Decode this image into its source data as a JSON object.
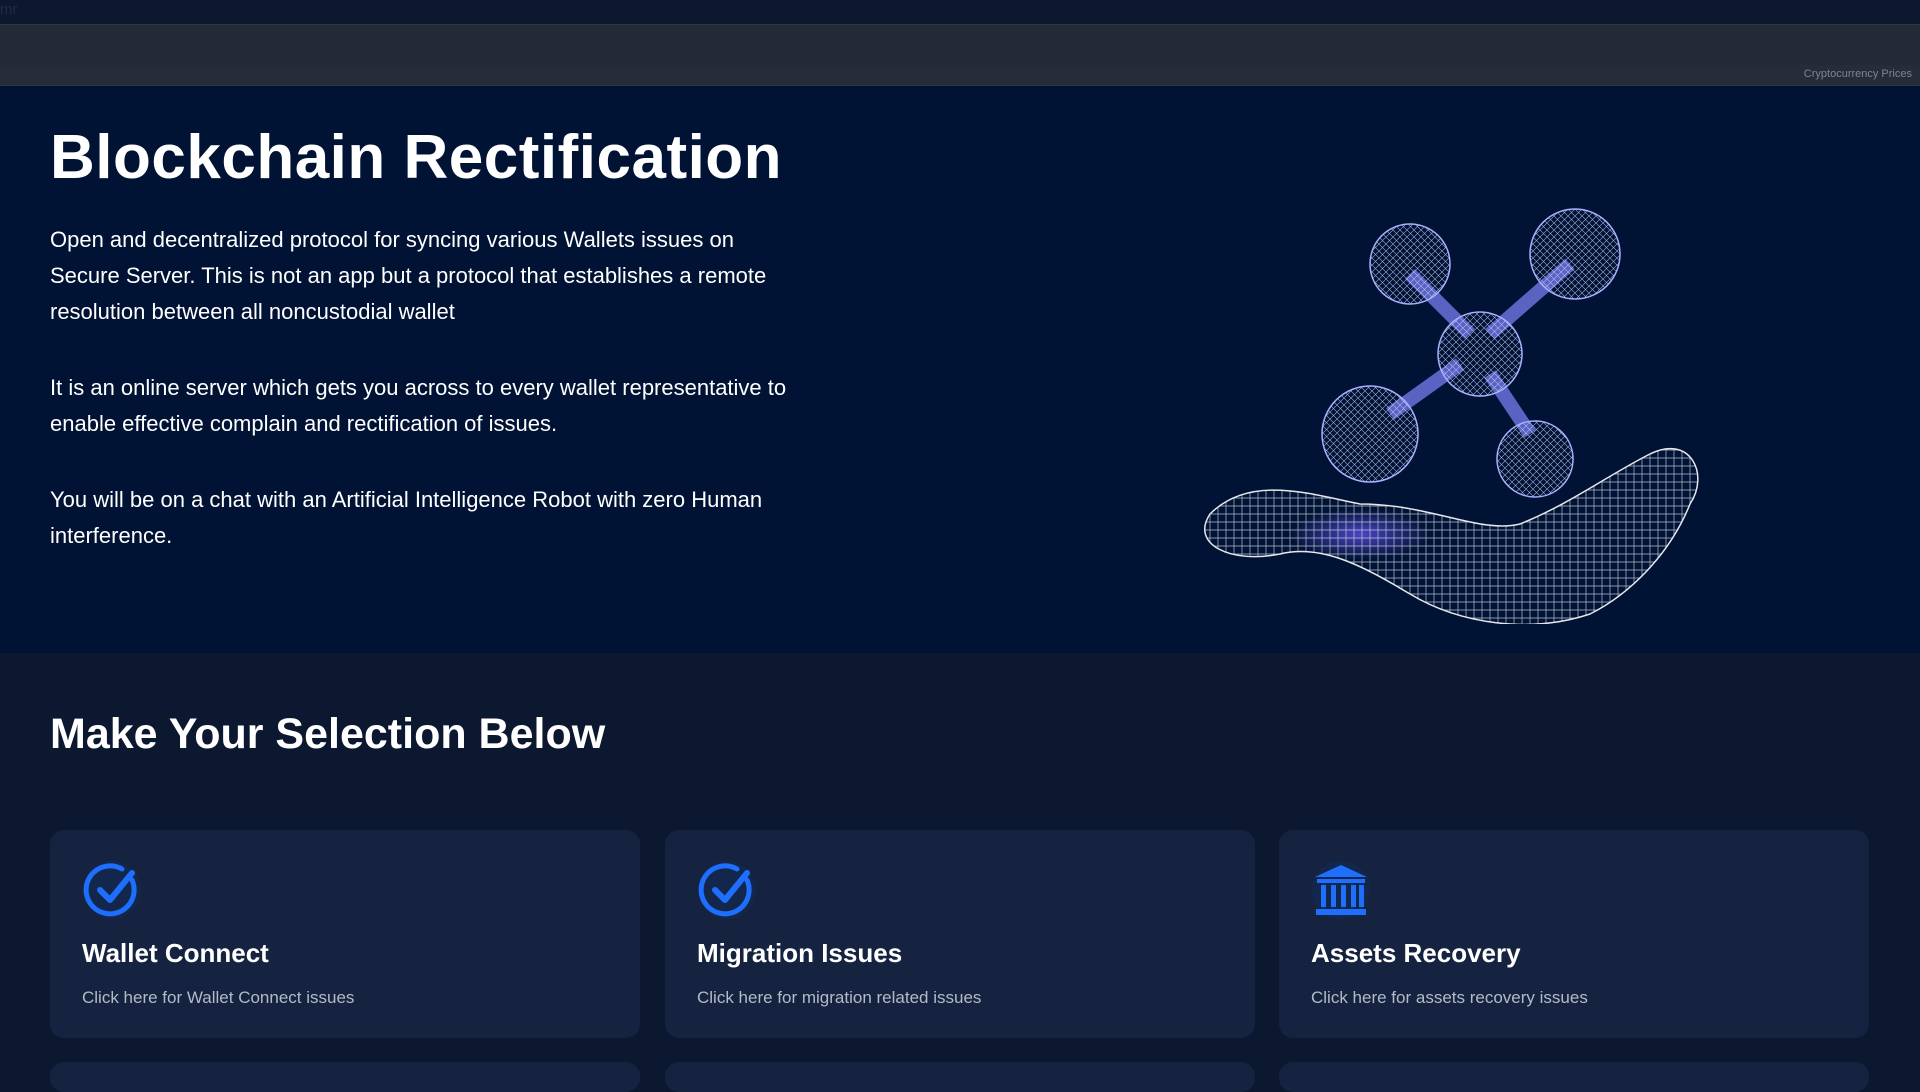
{
  "top_code": "mr",
  "ticker": {
    "credit": "Cryptocurrency Prices"
  },
  "hero": {
    "title": "Blockchain Rectification",
    "paragraphs": [
      "Open and decentralized protocol for syncing various Wallets issues on Secure Server. This is not an app but a protocol that establishes a remote resolution between all noncustodial wallet",
      "It is an online server which gets you across to every wallet representative to enable effective complain and rectification of issues.",
      "You will be on a chat with an Artificial Intelligence Robot with zero Human interference."
    ]
  },
  "selection": {
    "title": "Make Your Selection Below",
    "cards": [
      {
        "title": "Wallet Connect",
        "desc": "Click here for Wallet Connect issues",
        "icon": "check-circle-icon"
      },
      {
        "title": "Migration Issues",
        "desc": "Click here for migration related issues",
        "icon": "check-circle-icon"
      },
      {
        "title": "Assets Recovery",
        "desc": "Click here for assets recovery issues",
        "icon": "bank-icon"
      }
    ]
  },
  "colors": {
    "accent": "#1f6fff",
    "hero_bg": "#011334",
    "page_bg": "#0b1830",
    "card_bg": "#162340"
  }
}
